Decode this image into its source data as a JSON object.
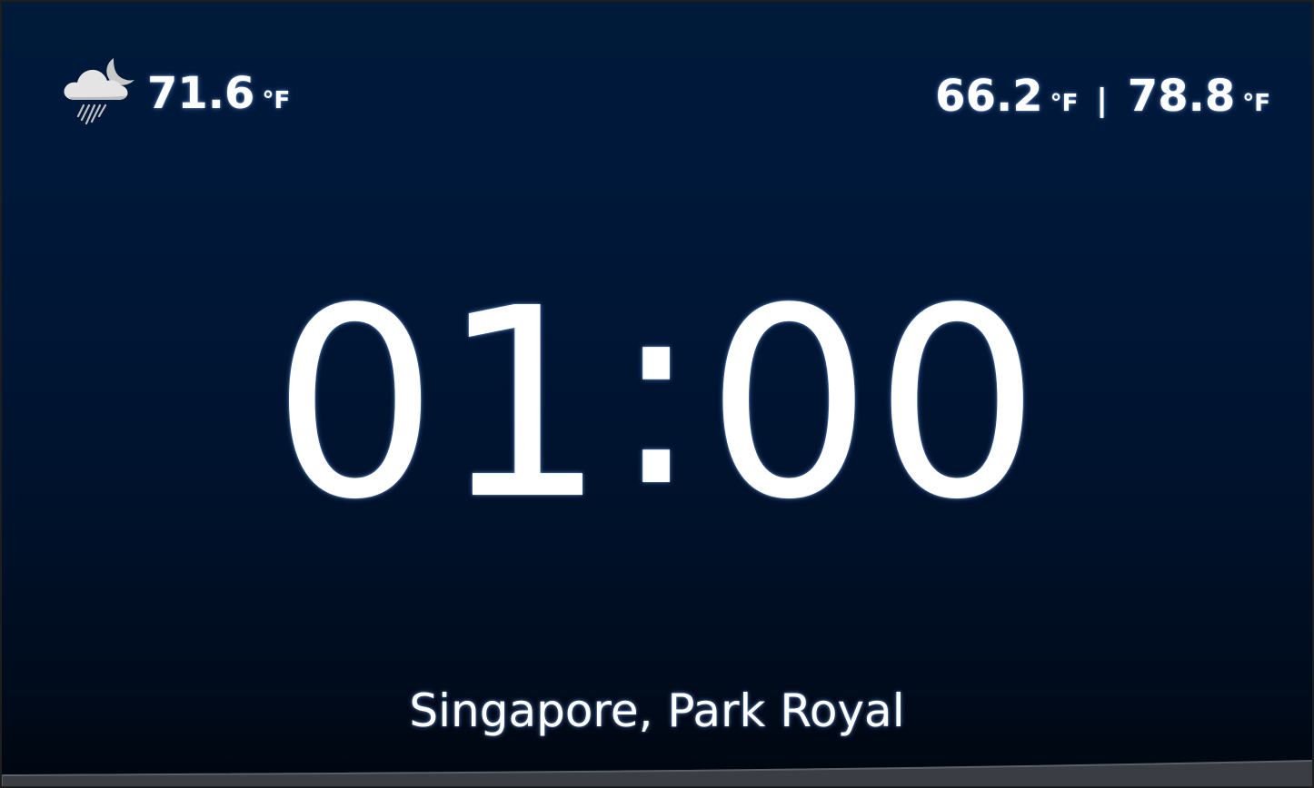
{
  "weather": {
    "icon": "night-cloud-rain-icon",
    "current_temp": "71.6",
    "current_unit": "°F",
    "low_temp": "66.2",
    "low_unit": "°F",
    "separator": "|",
    "high_temp": "78.8",
    "high_unit": "°F"
  },
  "clock": {
    "hours": "01",
    "colon": ":",
    "minutes": "00"
  },
  "location": "Singapore, Park Royal",
  "colors": {
    "background_top": "#001a3a",
    "background_bottom": "#00060f",
    "text": "#ffffff",
    "glow": "#78aaff"
  }
}
